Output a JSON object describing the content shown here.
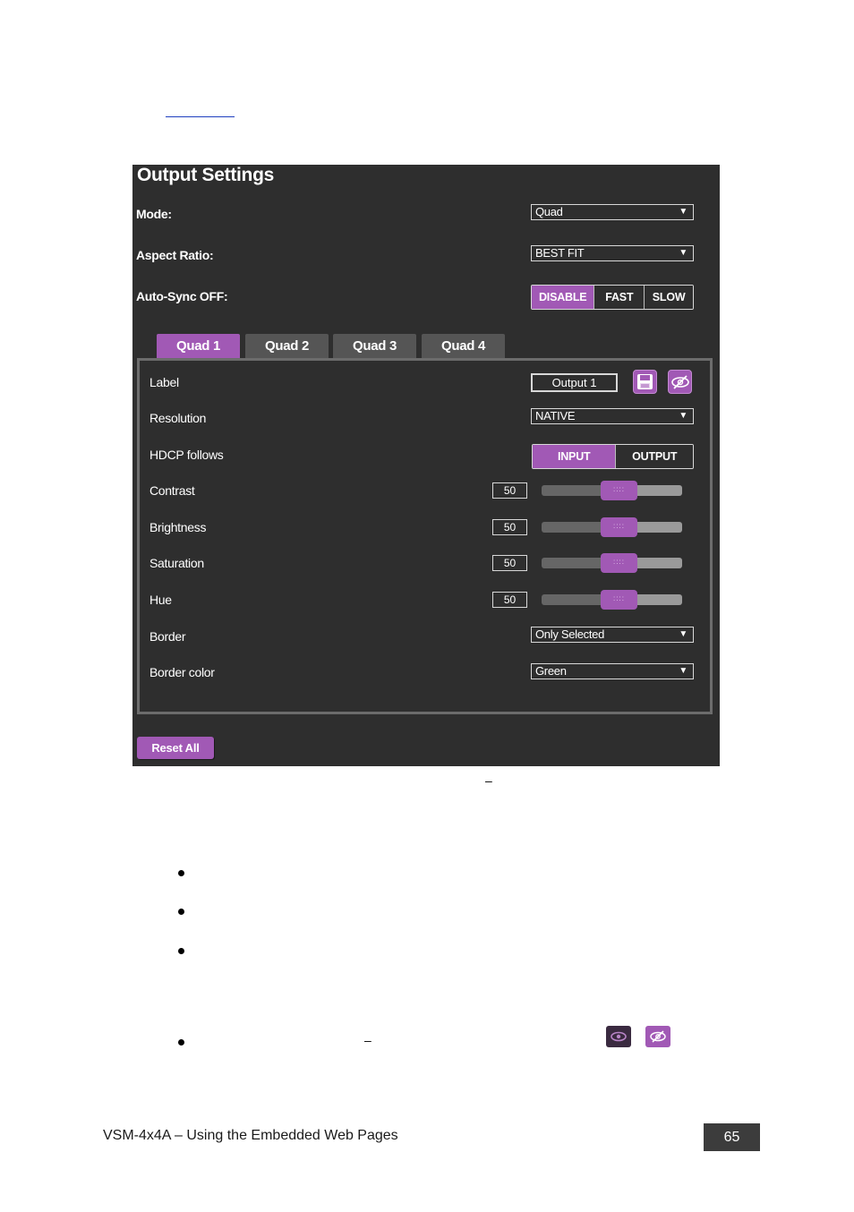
{
  "panel": {
    "title": "Output Settings",
    "mode": {
      "label": "Mode:",
      "value": "Quad"
    },
    "aspect_ratio": {
      "label": "Aspect Ratio:",
      "value": "BEST FIT"
    },
    "auto_sync": {
      "label": "Auto-Sync OFF:",
      "options": [
        "DISABLE",
        "FAST",
        "SLOW"
      ],
      "selected": "DISABLE"
    },
    "tabs": [
      {
        "label": "Quad 1",
        "active": true
      },
      {
        "label": "Quad 2",
        "active": false
      },
      {
        "label": "Quad 3",
        "active": false
      },
      {
        "label": "Quad 4",
        "active": false
      }
    ],
    "quad": {
      "label_row": {
        "label": "Label",
        "value": "Output  1"
      },
      "resolution": {
        "label": "Resolution",
        "value": "NATIVE"
      },
      "hdcp": {
        "label": "HDCP follows",
        "options": [
          "INPUT",
          "OUTPUT"
        ],
        "selected": "INPUT"
      },
      "contrast": {
        "label": "Contrast",
        "value": "50",
        "level": 0.5
      },
      "brightness": {
        "label": "Brightness",
        "value": "50",
        "level": 0.5
      },
      "saturation": {
        "label": "Saturation",
        "value": "50",
        "level": 0.5
      },
      "hue": {
        "label": "Hue",
        "value": "50",
        "level": 0.5
      },
      "border": {
        "label": "Border",
        "value": "Only Selected"
      },
      "border_color": {
        "label": "Border color",
        "value": "Green"
      }
    },
    "reset_label": "Reset All",
    "icons": {
      "save": "save-icon",
      "hide": "eye-slash-icon"
    }
  },
  "page": {
    "dash1": "–",
    "dash2": "–",
    "icons": [
      "eye-icon",
      "eye-slash-icon"
    ],
    "footer": "VSM-4x4A – Using the Embedded Web Pages",
    "page_number": "65"
  },
  "colors": {
    "accent": "#a159b5",
    "panel_bg": "#2e2e2e"
  }
}
